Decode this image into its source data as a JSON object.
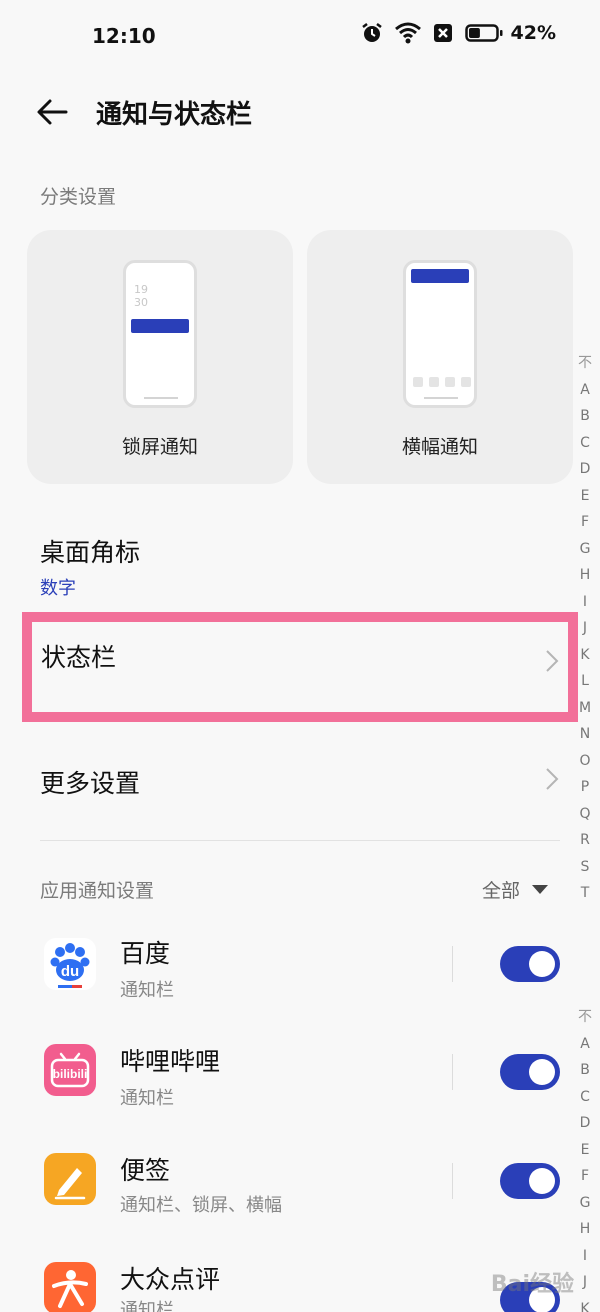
{
  "status_bar": {
    "time": "12:10",
    "battery_percent": "42%",
    "battery_level": 0.42,
    "icons": [
      "alarm-icon",
      "wifi-icon",
      "no-sim-icon",
      "battery-icon"
    ]
  },
  "header": {
    "title": "通知与状态栏",
    "back_icon": "back-arrow-icon"
  },
  "category": {
    "label": "分类设置",
    "cards": [
      {
        "label": "锁屏通知",
        "preview_time": [
          "19",
          "30"
        ]
      },
      {
        "label": "横幅通知"
      }
    ]
  },
  "badge_row": {
    "title": "桌面角标",
    "value": "数字"
  },
  "status_bar_row": {
    "title": "状态栏"
  },
  "more_row": {
    "title": "更多设置"
  },
  "app_section": {
    "label": "应用通知设置",
    "filter": "全部",
    "apps": [
      {
        "name": "百度",
        "sub": "通知栏",
        "icon": "baidu-icon",
        "icon_text": "du",
        "enabled": true
      },
      {
        "name": "哔哩哔哩",
        "sub": "通知栏",
        "icon": "bilibili-icon",
        "icon_text": "bilibili",
        "enabled": true
      },
      {
        "name": "便签",
        "sub": "通知栏、锁屏、横幅",
        "icon": "notes-icon",
        "enabled": true
      },
      {
        "name": "大众点评",
        "sub": "通知栏",
        "icon": "dianping-icon",
        "enabled": true
      }
    ]
  },
  "index_bar_1": [
    "A",
    "B",
    "C",
    "D",
    "E",
    "F",
    "G",
    "H",
    "I",
    "J",
    "K",
    "L",
    "M",
    "N",
    "O",
    "P",
    "Q",
    "R",
    "S",
    "T"
  ],
  "index_bar_2": [
    "A",
    "B",
    "C",
    "D",
    "E",
    "F",
    "G",
    "H",
    "I",
    "J",
    "K"
  ],
  "watermark": "Bai经验",
  "colors": {
    "accent": "#2a3fb8",
    "highlight": "#f27099",
    "background": "#f8f8f8"
  }
}
